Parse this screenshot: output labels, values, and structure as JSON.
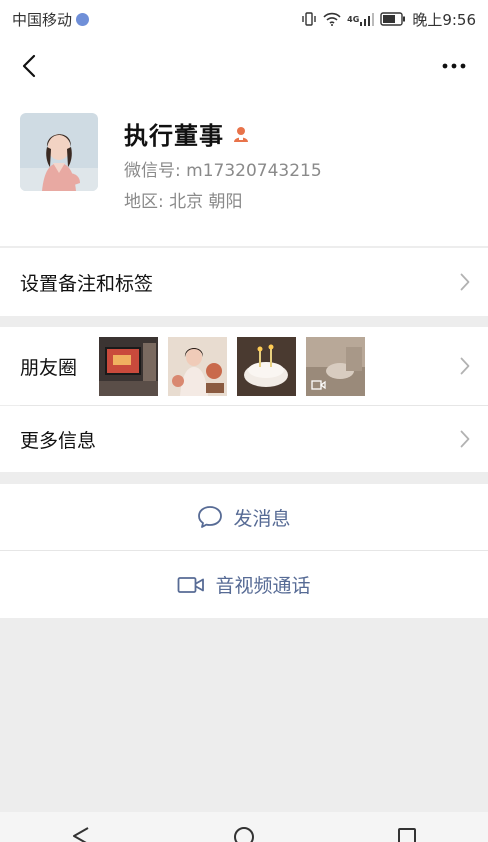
{
  "status_bar": {
    "carrier": "中国移动",
    "network": "4G",
    "time": "晚上9:56"
  },
  "contact": {
    "name": "执行董事",
    "wechat_id": "微信号: m17320743215",
    "region": "地区:  北京  朝阳"
  },
  "rows": {
    "remark_tags": "设置备注和标签",
    "moments": "朋友圈",
    "more_info": "更多信息"
  },
  "actions": {
    "send_message": "发消息",
    "video_call": "音视频通话"
  },
  "colors": {
    "link_blue": "#576b95",
    "verified_orange": "#e8734a",
    "background": "#ededed"
  },
  "icons": [
    "back-arrow-icon",
    "more-dots-icon",
    "person-badge-icon",
    "chevron-right-icon",
    "chat-bubble-icon",
    "video-camera-icon",
    "nav-back-icon",
    "nav-home-icon",
    "nav-recents-icon"
  ]
}
